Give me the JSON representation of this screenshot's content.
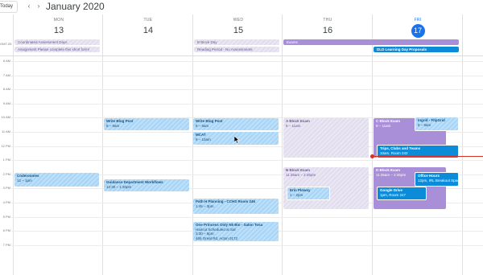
{
  "toolbar": {
    "today_label": "Today",
    "prev_icon": "‹",
    "next_icon": "›",
    "month_title": "January 2020"
  },
  "days": [
    {
      "dow": "MON",
      "num": "13"
    },
    {
      "dow": "TUE",
      "num": "14"
    },
    {
      "dow": "WED",
      "num": "15"
    },
    {
      "dow": "THU",
      "num": "16"
    },
    {
      "dow": "FRI",
      "num": "17"
    }
  ],
  "allday_label": "GMT-05",
  "times": [
    "6 AM",
    "7 AM",
    "8 AM",
    "9 AM",
    "10 AM",
    "11 AM",
    "12 PM",
    "1 PM",
    "2 PM",
    "3 PM",
    "4 PM",
    "5 PM",
    "6 PM",
    "7 PM"
  ],
  "allday_events": {
    "mon1": "Coordinated Assessment Days",
    "mon2": "Assignment Please complete this short form!",
    "wed1": "B Block Day",
    "wed2": "Reading Period - No Assessments",
    "thu1": "Exams",
    "fri1": "DLD Learning Day Proposals"
  },
  "events": {
    "mon_coder": {
      "title": "Coderoonies",
      "sub": "12 – 1pm"
    },
    "tue_blog": {
      "title": "Write Blog Post",
      "sub": "8 – 9am"
    },
    "tue_guid": {
      "title": "Guidance Department Workflows",
      "sub": "12:30 – 1:30pm"
    },
    "wed_blog": {
      "title": "Write Blog Post",
      "sub": "8 – 9am"
    },
    "wed_mcat": {
      "title": "MCAT",
      "sub": "9 – 10am"
    },
    "wed_path": {
      "title": "Path H Planning - CCHS Room 246",
      "sub": "1:45 – 3pm"
    },
    "wed_princess": {
      "title": "One Princess Only N5 Bio - Salon Tosa",
      "sub": "Haircut Scheduled at Sal",
      "sub2": "3:30 – 5pm",
      "sub3": "465 Great Rd, Acton 0172"
    },
    "thu_a": {
      "title": "A Block Exam",
      "sub": "8 – 11am"
    },
    "thu_b": {
      "title": "B Block Exam",
      "sub": "11:35am – 2:45pm"
    },
    "thu_erin": {
      "title": "Erin Plowsy",
      "sub": "1 – 2pm"
    },
    "fri_c": {
      "title": "C Block Exam",
      "sub": "8 – 11am"
    },
    "fri_ingrid": {
      "title": "Ingrid - FlipGrid",
      "sub": "8 – 9am"
    },
    "fri_trips": {
      "title": "Trips, Clubs and Teams",
      "sub": "10am, Room 242"
    },
    "fri_d": {
      "title": "D Block Exam",
      "sub": "11:35am – 2:45pm"
    },
    "fri_office": {
      "title": "Office Hours",
      "sub": "12pm, IRL Breakout Space"
    },
    "fri_gdrive": {
      "title": "Google Drive",
      "sub": "1pm, Room 247"
    }
  },
  "colors": {
    "today": "#1a73e8",
    "now_line": "#d93025",
    "event_light_blue": "#a8d5f7",
    "event_lavender": "#e1dcee",
    "event_purple": "#a98fd8",
    "event_blue": "#0b8bd8"
  },
  "icons": {
    "prev": "chevron-left-icon",
    "next": "chevron-right-icon"
  }
}
